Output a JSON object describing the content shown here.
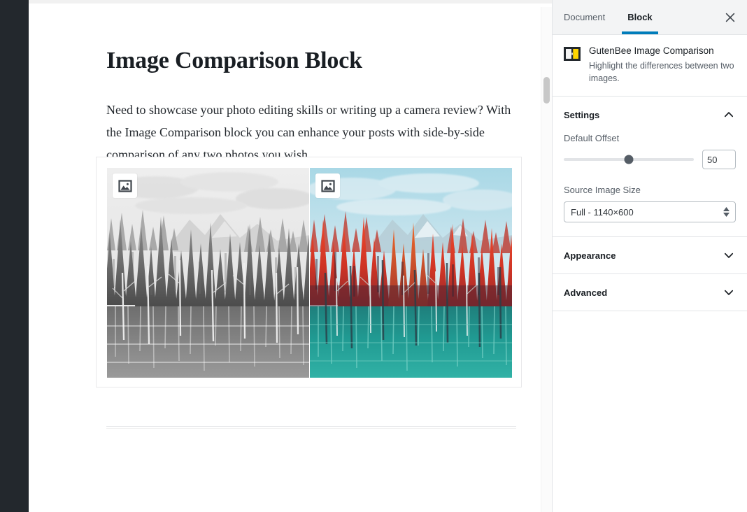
{
  "editor": {
    "post_title": "Image Comparison Block",
    "post_paragraph": "Need to showcase your photo editing skills or writing up a camera review? With the Image Comparison block you can enhance your posts with side-by-side comparison of any two photos you wish.",
    "block": {
      "left_media_button_icon": "image-icon",
      "right_media_button_icon": "image-icon",
      "left_image_alt": "Grayscale forest and lake",
      "right_image_alt": "Autumn red forest and teal lake"
    }
  },
  "sidebar": {
    "tabs": [
      {
        "label": "Document",
        "active": false
      },
      {
        "label": "Block",
        "active": true
      }
    ],
    "close_icon": "close-icon",
    "block_info": {
      "icon": "gutenbee-image-comparison-icon",
      "title": "GutenBee Image Comparison",
      "description": "Highlight the differences between two images."
    },
    "panels": [
      {
        "title": "Settings",
        "expanded": true,
        "chevron": "chevron-up-icon"
      },
      {
        "title": "Appearance",
        "expanded": false,
        "chevron": "chevron-down-icon"
      },
      {
        "title": "Advanced",
        "expanded": false,
        "chevron": "chevron-down-icon"
      }
    ],
    "settings": {
      "default_offset_label": "Default Offset",
      "default_offset_value": "50",
      "default_offset_percent": 50,
      "source_image_size_label": "Source Image Size",
      "source_image_size_value": "Full - 1140×600"
    }
  },
  "colors": {
    "accent_blue": "#007cba",
    "admin_dark": "#23282d",
    "panel_border": "#e2e4e7",
    "tab_bg": "#f3f4f5",
    "gutenbee_yellow": "#ffd500"
  }
}
